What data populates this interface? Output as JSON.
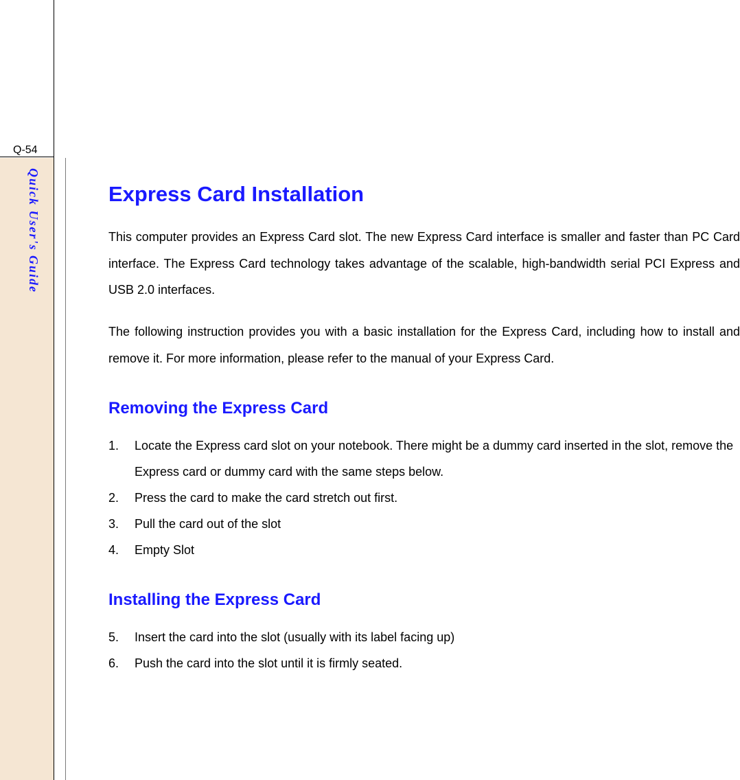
{
  "page_number": "Q-54",
  "sidebar_label": "Quick User's Guide",
  "main_heading": "Express Card Installation",
  "paragraph_1": "This computer provides an Express Card slot.  The new Express Card interface is smaller and faster than PC Card interface.  The Express Card technology takes advantage of the scalable, high-bandwidth serial PCI Express and USB 2.0 interfaces.",
  "paragraph_2": "The following instruction provides you with a basic installation for the Express Card, including how to install and remove it.    For more information, please refer to the manual of your Express Card.",
  "sub_heading_1": "Removing the Express Card",
  "removing_list": [
    {
      "num": "1.",
      "text": "Locate the Express card slot on your notebook.    There might be a dummy card inserted in the slot, remove the Express card or dummy card with the same steps below."
    },
    {
      "num": "2.",
      "text": "Press the card to make the card stretch out first."
    },
    {
      "num": "3.",
      "text": "Pull the card out of the slot"
    },
    {
      "num": "4.",
      "text": "Empty Slot"
    }
  ],
  "sub_heading_2": "Installing the Express Card",
  "installing_list": [
    {
      "num": "5.",
      "text": "Insert the card into the slot (usually with its label facing up)"
    },
    {
      "num": "6.",
      "text": "Push the card into the slot until it is firmly seated."
    }
  ]
}
